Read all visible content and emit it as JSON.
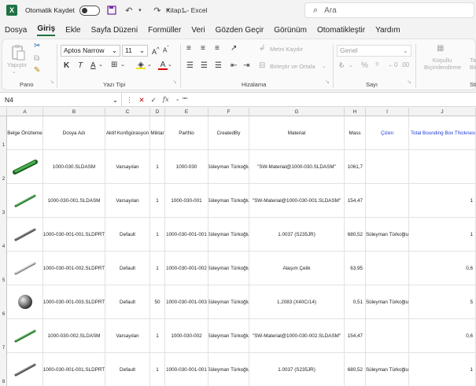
{
  "titlebar": {
    "autosave_label": "Otomatik Kaydet",
    "doc_title": "Kitap1  -  Excel",
    "search_placeholder": "Ara"
  },
  "menu": [
    "Dosya",
    "Giriş",
    "Ekle",
    "Sayfa Düzeni",
    "Formüller",
    "Veri",
    "Gözden Geçir",
    "Görünüm",
    "Otomatikleştir",
    "Yardım"
  ],
  "ribbon": {
    "paste_label": "Yapıştır",
    "group_pano": "Pano",
    "font_name": "Aptos Narrow",
    "font_size": "11",
    "bold": "K",
    "italic": "T",
    "underline": "A",
    "group_font": "Yazı Tipi",
    "merge_label": "Metni Kaydır",
    "center_merge_label": "Birleştir ve Ortala",
    "group_align": "Hizalama",
    "number_format": "Genel",
    "group_number": "Sayı",
    "cond_format_label": "Koşullu Biçimlendirme",
    "table_label": "Ta... Biç...",
    "style_group": "Stil"
  },
  "formula_bar": {
    "cell_ref": "N4",
    "fx": "fx",
    "value": "\"\""
  },
  "columns": [
    "A",
    "B",
    "C",
    "D",
    "E",
    "F",
    "G",
    "H",
    "I",
    "J"
  ],
  "header_row": [
    "Belge Önizleme",
    "Dosya Adı",
    "Aktif Konfigürasyon",
    "Miktar",
    "PartNo",
    "CreatedBy",
    "Material",
    "Mass",
    "Çizen",
    "Total Bounding Box Thickness"
  ],
  "rows": [
    {
      "num": "2",
      "file": "1000-030.SLDASM",
      "config": "Varsayılan",
      "qty": "1",
      "part": "1000-030",
      "by": "Süleyman Türkoğlu",
      "material": "\"SW-Material@1000-030.SLDASM\"",
      "mass": "1061,7",
      "drawn": "",
      "thick": "",
      "thumb": "green-assembly"
    },
    {
      "num": "3",
      "file": "1000-030-001.SLDASM",
      "config": "Varsayılan",
      "qty": "1",
      "part": "1000-030-001",
      "by": "Süleyman Türkoğlu",
      "material": "\"SW-Material@1000-030-001.SLDASM\"",
      "mass": "154,47",
      "drawn": "",
      "thick": "1",
      "thumb": "green-rod"
    },
    {
      "num": "4",
      "file": "1000-030-001-001.SLDPRT",
      "config": "Default",
      "qty": "1",
      "part": "1000-030-001-001",
      "by": "Süleyman Türkoğlu",
      "material": "1.0037 (S235JR)",
      "mass": "680,52",
      "drawn": "Süleyman Türkoğlu",
      "thick": "1",
      "thumb": "grey-rod"
    },
    {
      "num": "5",
      "file": "1000-030-001-002.SLDPRT",
      "config": "Default",
      "qty": "1",
      "part": "1000-030-001-002",
      "by": "Süleyman Türkoğlu",
      "material": "Alaşım Çelik",
      "mass": "63,95",
      "drawn": "",
      "thick": "0,6",
      "thumb": "light-rod"
    },
    {
      "num": "6",
      "file": "1000-030-001-003.SLDPRT",
      "config": "Default",
      "qty": "50",
      "part": "1000-030-001-003",
      "by": "Süleyman Türkoğlu",
      "material": "1.2083 (X40Cr14)",
      "mass": "0,51",
      "drawn": "Süleyman Türkoğlu",
      "thick": "5",
      "thumb": "sphere"
    },
    {
      "num": "7",
      "file": "1000-030-002.SLDASM",
      "config": "Varsayılan",
      "qty": "1",
      "part": "1000-030-002",
      "by": "Süleyman Türkoğlu",
      "material": "\"SW-Material@1000-030-002.SLDASM\"",
      "mass": "154,47",
      "drawn": "",
      "thick": "0,6",
      "thumb": "green-rod"
    },
    {
      "num": "8",
      "file": "1000-030-001-001.SLDPRT",
      "config": "Default",
      "qty": "1",
      "part": "1000-030-001-001",
      "by": "Süleyman Türkoğlu",
      "material": "1.0037 (S235JR)",
      "mass": "680,52",
      "drawn": "Süleyman Türkoğlu",
      "thick": "1",
      "thumb": "grey-rod"
    }
  ]
}
